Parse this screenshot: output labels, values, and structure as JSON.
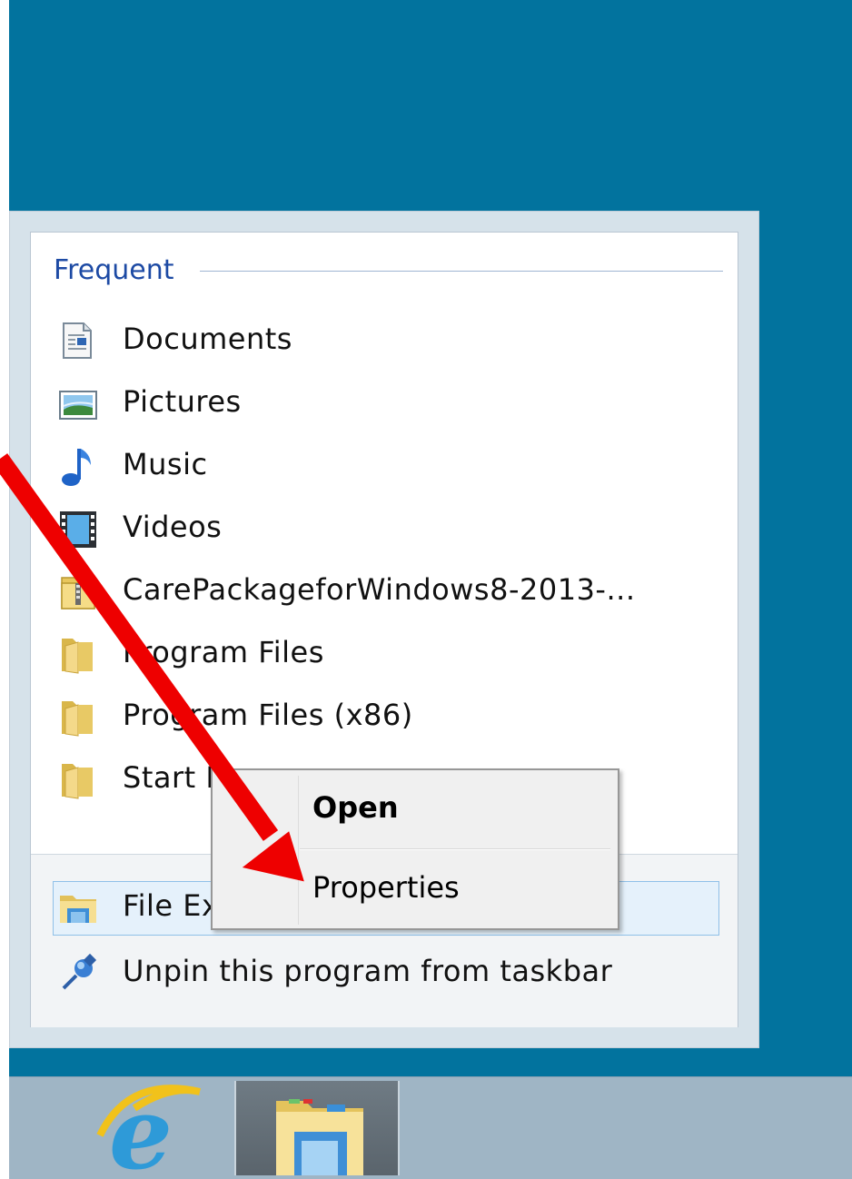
{
  "jumplist": {
    "section_title": "Frequent",
    "items": [
      {
        "label": "Documents",
        "icon": "documents-icon"
      },
      {
        "label": "Pictures",
        "icon": "pictures-icon"
      },
      {
        "label": "Music",
        "icon": "music-icon"
      },
      {
        "label": "Videos",
        "icon": "videos-icon"
      },
      {
        "label": "CarePackageforWindows8-2013-...",
        "icon": "zip-folder-icon"
      },
      {
        "label": "Program Files",
        "icon": "folder-icon"
      },
      {
        "label": "Program Files (x86)",
        "icon": "folder-icon"
      },
      {
        "label": "Start Menu",
        "icon": "folder-icon"
      }
    ],
    "tasks": [
      {
        "label": "File Explorer",
        "icon": "file-explorer-icon"
      },
      {
        "label": "Unpin this program from taskbar",
        "icon": "unpin-icon"
      }
    ]
  },
  "context_menu": {
    "open_label": "Open",
    "properties_label": "Properties"
  },
  "taskbar": {
    "buttons": [
      {
        "name": "Internet Explorer",
        "icon": "internet-explorer-icon"
      },
      {
        "name": "File Explorer",
        "icon": "file-explorer-icon"
      }
    ]
  },
  "colors": {
    "desktop": "#02739e",
    "header_text": "#1d4aa4",
    "arrow": "#ee0000",
    "taskbar": "#9fb5c5"
  }
}
